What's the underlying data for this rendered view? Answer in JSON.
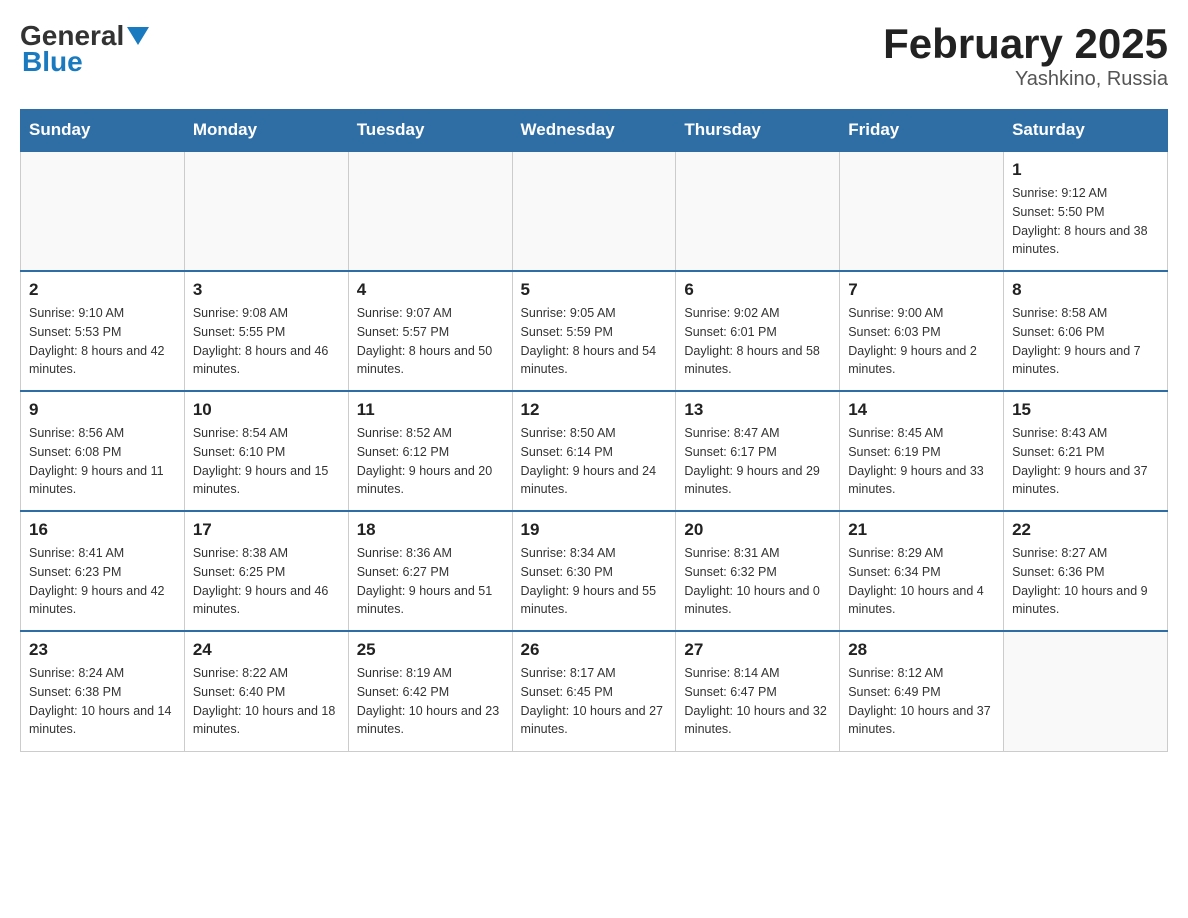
{
  "header": {
    "logo_general": "General",
    "logo_blue": "Blue",
    "month_title": "February 2025",
    "subtitle": "Yashkino, Russia"
  },
  "weekdays": [
    "Sunday",
    "Monday",
    "Tuesday",
    "Wednesday",
    "Thursday",
    "Friday",
    "Saturday"
  ],
  "weeks": [
    [
      {
        "day": "",
        "sunrise": "",
        "sunset": "",
        "daylight": ""
      },
      {
        "day": "",
        "sunrise": "",
        "sunset": "",
        "daylight": ""
      },
      {
        "day": "",
        "sunrise": "",
        "sunset": "",
        "daylight": ""
      },
      {
        "day": "",
        "sunrise": "",
        "sunset": "",
        "daylight": ""
      },
      {
        "day": "",
        "sunrise": "",
        "sunset": "",
        "daylight": ""
      },
      {
        "day": "",
        "sunrise": "",
        "sunset": "",
        "daylight": ""
      },
      {
        "day": "1",
        "sunrise": "Sunrise: 9:12 AM",
        "sunset": "Sunset: 5:50 PM",
        "daylight": "Daylight: 8 hours and 38 minutes."
      }
    ],
    [
      {
        "day": "2",
        "sunrise": "Sunrise: 9:10 AM",
        "sunset": "Sunset: 5:53 PM",
        "daylight": "Daylight: 8 hours and 42 minutes."
      },
      {
        "day": "3",
        "sunrise": "Sunrise: 9:08 AM",
        "sunset": "Sunset: 5:55 PM",
        "daylight": "Daylight: 8 hours and 46 minutes."
      },
      {
        "day": "4",
        "sunrise": "Sunrise: 9:07 AM",
        "sunset": "Sunset: 5:57 PM",
        "daylight": "Daylight: 8 hours and 50 minutes."
      },
      {
        "day": "5",
        "sunrise": "Sunrise: 9:05 AM",
        "sunset": "Sunset: 5:59 PM",
        "daylight": "Daylight: 8 hours and 54 minutes."
      },
      {
        "day": "6",
        "sunrise": "Sunrise: 9:02 AM",
        "sunset": "Sunset: 6:01 PM",
        "daylight": "Daylight: 8 hours and 58 minutes."
      },
      {
        "day": "7",
        "sunrise": "Sunrise: 9:00 AM",
        "sunset": "Sunset: 6:03 PM",
        "daylight": "Daylight: 9 hours and 2 minutes."
      },
      {
        "day": "8",
        "sunrise": "Sunrise: 8:58 AM",
        "sunset": "Sunset: 6:06 PM",
        "daylight": "Daylight: 9 hours and 7 minutes."
      }
    ],
    [
      {
        "day": "9",
        "sunrise": "Sunrise: 8:56 AM",
        "sunset": "Sunset: 6:08 PM",
        "daylight": "Daylight: 9 hours and 11 minutes."
      },
      {
        "day": "10",
        "sunrise": "Sunrise: 8:54 AM",
        "sunset": "Sunset: 6:10 PM",
        "daylight": "Daylight: 9 hours and 15 minutes."
      },
      {
        "day": "11",
        "sunrise": "Sunrise: 8:52 AM",
        "sunset": "Sunset: 6:12 PM",
        "daylight": "Daylight: 9 hours and 20 minutes."
      },
      {
        "day": "12",
        "sunrise": "Sunrise: 8:50 AM",
        "sunset": "Sunset: 6:14 PM",
        "daylight": "Daylight: 9 hours and 24 minutes."
      },
      {
        "day": "13",
        "sunrise": "Sunrise: 8:47 AM",
        "sunset": "Sunset: 6:17 PM",
        "daylight": "Daylight: 9 hours and 29 minutes."
      },
      {
        "day": "14",
        "sunrise": "Sunrise: 8:45 AM",
        "sunset": "Sunset: 6:19 PM",
        "daylight": "Daylight: 9 hours and 33 minutes."
      },
      {
        "day": "15",
        "sunrise": "Sunrise: 8:43 AM",
        "sunset": "Sunset: 6:21 PM",
        "daylight": "Daylight: 9 hours and 37 minutes."
      }
    ],
    [
      {
        "day": "16",
        "sunrise": "Sunrise: 8:41 AM",
        "sunset": "Sunset: 6:23 PM",
        "daylight": "Daylight: 9 hours and 42 minutes."
      },
      {
        "day": "17",
        "sunrise": "Sunrise: 8:38 AM",
        "sunset": "Sunset: 6:25 PM",
        "daylight": "Daylight: 9 hours and 46 minutes."
      },
      {
        "day": "18",
        "sunrise": "Sunrise: 8:36 AM",
        "sunset": "Sunset: 6:27 PM",
        "daylight": "Daylight: 9 hours and 51 minutes."
      },
      {
        "day": "19",
        "sunrise": "Sunrise: 8:34 AM",
        "sunset": "Sunset: 6:30 PM",
        "daylight": "Daylight: 9 hours and 55 minutes."
      },
      {
        "day": "20",
        "sunrise": "Sunrise: 8:31 AM",
        "sunset": "Sunset: 6:32 PM",
        "daylight": "Daylight: 10 hours and 0 minutes."
      },
      {
        "day": "21",
        "sunrise": "Sunrise: 8:29 AM",
        "sunset": "Sunset: 6:34 PM",
        "daylight": "Daylight: 10 hours and 4 minutes."
      },
      {
        "day": "22",
        "sunrise": "Sunrise: 8:27 AM",
        "sunset": "Sunset: 6:36 PM",
        "daylight": "Daylight: 10 hours and 9 minutes."
      }
    ],
    [
      {
        "day": "23",
        "sunrise": "Sunrise: 8:24 AM",
        "sunset": "Sunset: 6:38 PM",
        "daylight": "Daylight: 10 hours and 14 minutes."
      },
      {
        "day": "24",
        "sunrise": "Sunrise: 8:22 AM",
        "sunset": "Sunset: 6:40 PM",
        "daylight": "Daylight: 10 hours and 18 minutes."
      },
      {
        "day": "25",
        "sunrise": "Sunrise: 8:19 AM",
        "sunset": "Sunset: 6:42 PM",
        "daylight": "Daylight: 10 hours and 23 minutes."
      },
      {
        "day": "26",
        "sunrise": "Sunrise: 8:17 AM",
        "sunset": "Sunset: 6:45 PM",
        "daylight": "Daylight: 10 hours and 27 minutes."
      },
      {
        "day": "27",
        "sunrise": "Sunrise: 8:14 AM",
        "sunset": "Sunset: 6:47 PM",
        "daylight": "Daylight: 10 hours and 32 minutes."
      },
      {
        "day": "28",
        "sunrise": "Sunrise: 8:12 AM",
        "sunset": "Sunset: 6:49 PM",
        "daylight": "Daylight: 10 hours and 37 minutes."
      },
      {
        "day": "",
        "sunrise": "",
        "sunset": "",
        "daylight": ""
      }
    ]
  ]
}
